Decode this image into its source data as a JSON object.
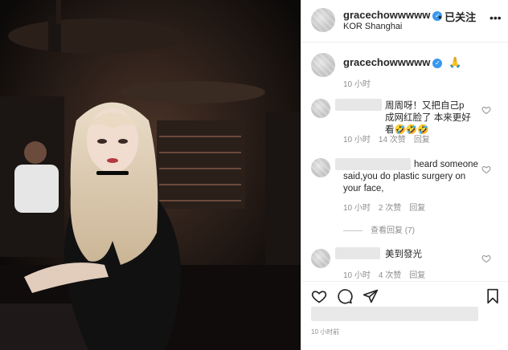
{
  "post": {
    "username": "gracechowwwww",
    "follow_label": "已关注",
    "location": "KOR Shanghai",
    "caption_username": "gracechowwwww",
    "caption_emoji": "🙏",
    "caption_time": "10 小时",
    "posted_time": "10 小时前"
  },
  "comments": [
    {
      "text": "周周呀！又把自己p成网红脸了 本来更好看🤣🤣🤣",
      "time": "10 小时",
      "likes": "14 次赞",
      "reply": "回复"
    },
    {
      "text": "heard someone said,you do plastic surgery on your face,",
      "time": "10 小时",
      "likes": "2 次赞",
      "reply": "回复",
      "view_replies": "查看回复 (7)"
    },
    {
      "text": "美到發光",
      "time": "10 小时",
      "likes": "4 次赞",
      "reply": "回复"
    }
  ],
  "icons": {
    "verified": "verified-badge-icon",
    "more": "more-options-icon",
    "like": "heart-icon",
    "comment": "comment-icon",
    "share": "share-icon",
    "save": "bookmark-icon"
  },
  "colors": {
    "verified_blue": "#3897f0",
    "meta_gray": "#8e8e8e",
    "text": "#262626"
  }
}
